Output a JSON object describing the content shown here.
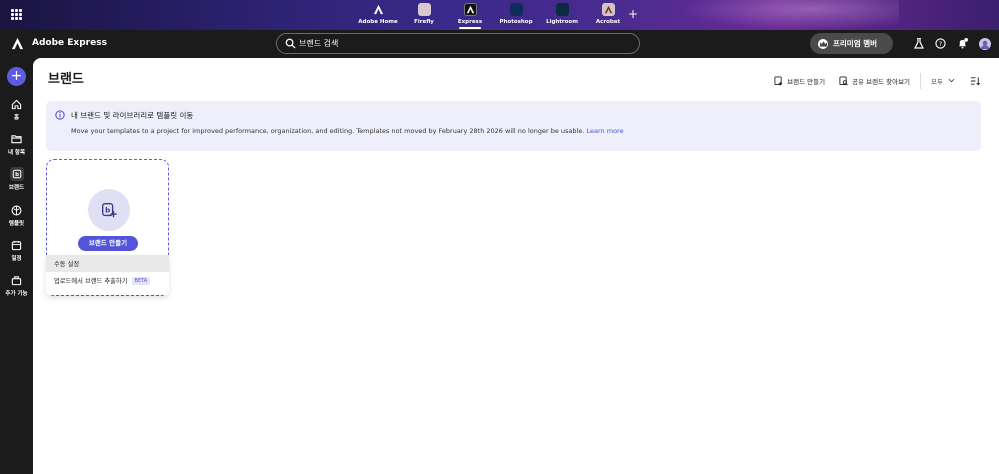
{
  "topbar": {
    "apps": [
      {
        "label": "Adobe Home",
        "color": "#1b1b1b",
        "glyph": "A",
        "icon": "adobe-home-icon"
      },
      {
        "label": "Firefly",
        "color": "#d9c6ce",
        "glyph": "",
        "icon": "firefly-icon"
      },
      {
        "label": "Express",
        "color": "#1b1b1b",
        "glyph": "A",
        "icon": "express-icon",
        "active": true
      },
      {
        "label": "Photoshop",
        "color": "#0e2d5c",
        "glyph": "Ps",
        "icon": "photoshop-icon"
      },
      {
        "label": "Lightroom",
        "color": "#0c2a42",
        "glyph": "Lr",
        "icon": "lightroom-icon"
      },
      {
        "label": "Acrobat",
        "color": "#cfc6c6",
        "glyph": "A",
        "icon": "acrobat-icon"
      }
    ]
  },
  "header": {
    "app_name": "Adobe Express",
    "search_placeholder": "브랜드 검색",
    "premium_label": "프리미엄 멤버"
  },
  "rail": {
    "items": [
      {
        "label": "홈",
        "icon": "home-icon"
      },
      {
        "label": "내 항목",
        "icon": "folder-icon"
      },
      {
        "label": "브랜드",
        "icon": "brand-icon",
        "active": true
      },
      {
        "label": "템플릿",
        "icon": "templates-icon"
      },
      {
        "label": "일정",
        "icon": "calendar-icon"
      },
      {
        "label": "추가 기능",
        "icon": "add-ons-icon"
      }
    ]
  },
  "main": {
    "title": "브랜드",
    "actions": {
      "create_brand": "브랜드 만들기",
      "find_shared": "공유 브랜드 찾아보기",
      "filter": "모두"
    },
    "banner": {
      "title": "내 브랜드 및 라이브러리로 템플릿 이동",
      "body": "Move your templates to a project for improved performance, organization, and editing. Templates not moved by February 28th 2026 will no longer be usable.",
      "link": "Learn more"
    },
    "create_card": {
      "button_label": "브랜드 만들기",
      "menu": [
        {
          "label": "수동 설정"
        },
        {
          "label": "업로드에서 브랜드 추출하기",
          "badge": "BETA"
        }
      ]
    }
  },
  "colors": {
    "accent": "#5c5ce0",
    "banner_bg": "#efeffc",
    "link": "#3d56d6"
  }
}
